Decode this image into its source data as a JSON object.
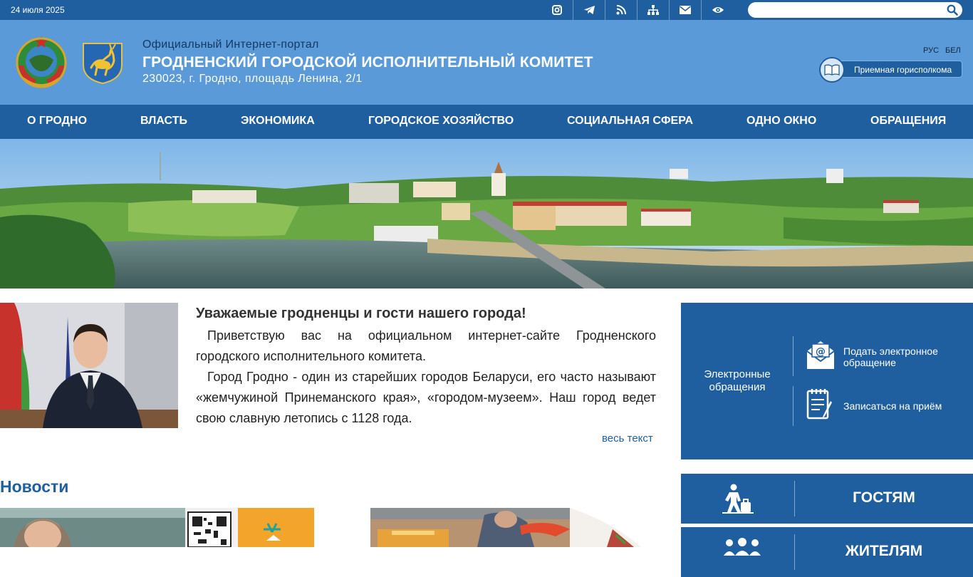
{
  "topbar": {
    "date": "24 июля 2025",
    "icons": [
      "instagram-icon",
      "telegram-icon",
      "rss-icon",
      "sitemap-icon",
      "mail-icon",
      "eye-icon"
    ],
    "search_placeholder": ""
  },
  "header": {
    "portal_label": "Официальный Интернет-портал",
    "org_name": "ГРОДНЕНСКИЙ ГОРОДСКОЙ ИСПОЛНИТЕЛЬНЫЙ КОМИТЕТ",
    "address": "230023, г. Гродно, площадь Ленина, 2/1",
    "lang_ru": "РУС",
    "lang_be": "БЕЛ",
    "reception_label": "Приемная горисполкома"
  },
  "nav": {
    "items": [
      "О ГРОДНО",
      "ВЛАСТЬ",
      "ЭКОНОМИКА",
      "ГОРОДСКОЕ ХОЗЯЙСТВО",
      "СОЦИАЛЬНАЯ СФЕРА",
      "ОДНО ОКНО",
      "ОБРАЩЕНИЯ"
    ]
  },
  "greeting": {
    "title": "Уважаемые гродненцы и гости нашего города!",
    "p1": "Приветствую вас на официальном интернет-сайте Гродненского городского исполнительного комитета.",
    "p2": "Город Гродно - один из старейших городов Беларуси, его часто называют «жемчужиной Принеманского края», «городом-музеем». Наш город ведет свою славную летопись с 1128 года.",
    "more": "весь текст"
  },
  "eappeals": {
    "title": "Электронные обращения",
    "submit": "Подать электронное обращение",
    "appointment": "Записаться на приём"
  },
  "tiles": {
    "guests": "ГОСТЯМ",
    "citizens": "ЖИТЕЛЯМ"
  },
  "news": {
    "heading": "Новости"
  },
  "colors": {
    "primary": "#1f5f9f",
    "header_bg": "#5a9ad8",
    "link": "#1f5f9f"
  }
}
